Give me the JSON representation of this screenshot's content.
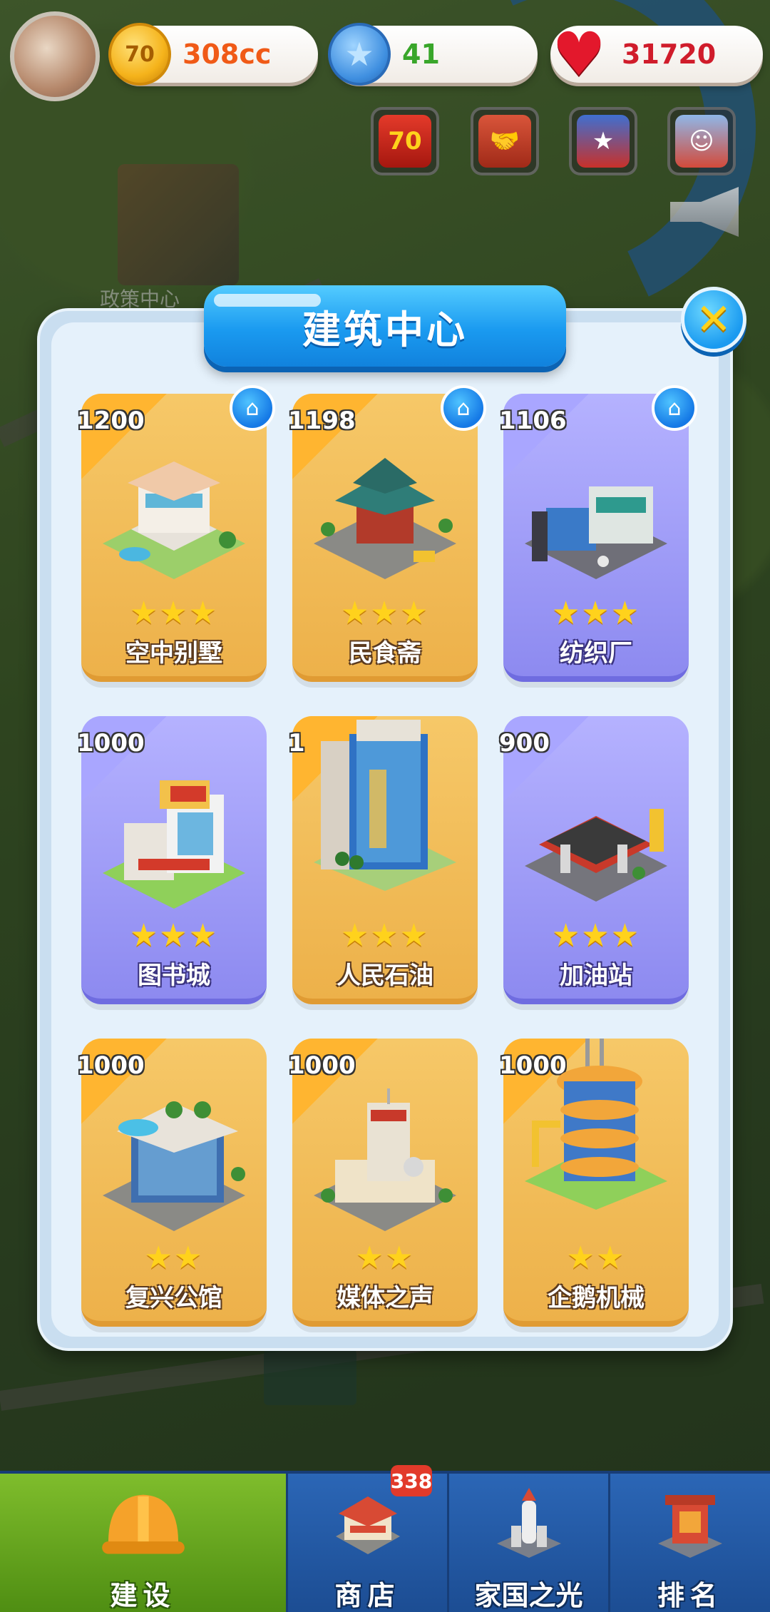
{
  "map": {
    "policy_label": "政策中心"
  },
  "resources": {
    "coin": {
      "icon": "coin-icon",
      "value": "308cc",
      "badge": "70"
    },
    "star": {
      "icon": "star-icon",
      "value": "41"
    },
    "heart": {
      "icon": "heart-icon",
      "value": "31720"
    }
  },
  "events": [
    {
      "icon": "anniversary-70-icon",
      "glyph": "70"
    },
    {
      "icon": "handshake-icon",
      "glyph": "🤝"
    },
    {
      "icon": "hero-event-icon",
      "glyph": "★"
    },
    {
      "icon": "character-event-icon",
      "glyph": "☺"
    }
  ],
  "modal": {
    "title": "建筑中心",
    "close_icon": "close-icon",
    "cards": [
      {
        "price": "1200",
        "name": "空中别墅",
        "stars": "★★★",
        "theme": "gold",
        "home": true
      },
      {
        "price": "1198",
        "name": "民食斋",
        "stars": "★★★",
        "theme": "gold",
        "home": true
      },
      {
        "price": "1106",
        "name": "纺织厂",
        "stars": "★★★",
        "theme": "purple",
        "home": true
      },
      {
        "price": "1000",
        "name": "图书城",
        "stars": "★★★",
        "theme": "purple",
        "home": false
      },
      {
        "price": "1",
        "name": "人民石油",
        "stars": "★★★",
        "theme": "gold",
        "home": false
      },
      {
        "price": "900",
        "name": "加油站",
        "stars": "★★★",
        "theme": "purple",
        "home": false
      },
      {
        "price": "1000",
        "name": "复兴公馆",
        "stars": "★★",
        "theme": "gold",
        "home": false
      },
      {
        "price": "1000",
        "name": "媒体之声",
        "stars": "★★",
        "theme": "gold",
        "home": false
      },
      {
        "price": "1000",
        "name": "企鹅机械",
        "stars": "★★",
        "theme": "gold",
        "home": false
      }
    ]
  },
  "nav": {
    "items": [
      {
        "label": "建设",
        "icon": "hard-hat-icon",
        "active": true
      },
      {
        "label": "商店",
        "icon": "shop-icon",
        "active": false
      },
      {
        "label": "家国之光",
        "icon": "rocket-icon",
        "active": false
      },
      {
        "label": "排名",
        "icon": "ranking-icon",
        "active": false
      }
    ],
    "shop_badge": "338"
  },
  "colors": {
    "gold_card": "#f2bd5a",
    "purple_card": "#a3a0fb",
    "nav_blue": "#2b66b6",
    "nav_active": "#6aa922",
    "title_blue": "#1a9af0"
  }
}
